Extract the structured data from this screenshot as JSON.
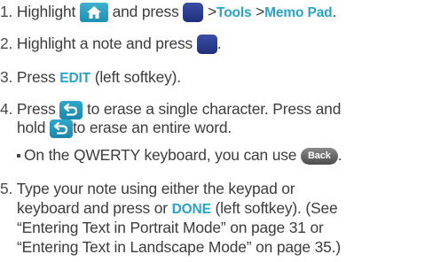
{
  "steps": [
    {
      "num": "1.",
      "t1": "Highlight",
      "t2": "and press",
      "t3": ">",
      "b1": "Tools",
      "t4": ">",
      "b2": "Memo Pad",
      "t5": "."
    },
    {
      "num": "2.",
      "t1": "Highlight a note and press",
      "t2": "."
    },
    {
      "num": "3.",
      "t1": "Press",
      "b1": "EDIT",
      "t2": "(left softkey)."
    },
    {
      "num": "4.",
      "t1": "Press",
      "t2": "to erase a single character. Press and",
      "t3": "hold",
      "t4": "to erase an entire word."
    },
    {
      "sub": "On the QWERTY keyboard, you can use",
      "pill": "Back",
      "end": "."
    },
    {
      "num": "5.",
      "t1": "Type your note using either the keypad or",
      "t2": "keyboard and press or",
      "b1": "DONE",
      "t3": "(left softkey). (See",
      "t4": "“Entering Text in Portrait Mode” on page 31 or",
      "t5": "“Entering Text in Landscape Mode” on page 35.)"
    }
  ],
  "icons": {
    "home": "home-icon",
    "menu_key": "center-key-icon",
    "back": "back-arrow-icon"
  },
  "colors": {
    "text": "#3c3c3c",
    "accent": "#2aa3c8",
    "key_dark_blue": "#25368a"
  }
}
